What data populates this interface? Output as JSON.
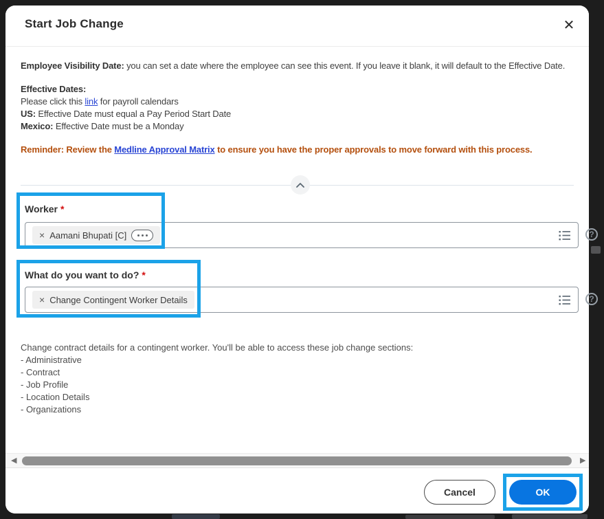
{
  "window": {
    "title": "Start Job Change"
  },
  "icons": {
    "close": "✕",
    "remove": "×",
    "help": "?",
    "scroll_left": "◀",
    "scroll_right": "▶"
  },
  "notices": {
    "visibility_label": "Employee Visibility Date:",
    "visibility_text": " you can set a date where the employee can see this event. If you leave it blank, it will default to the Effective Date.",
    "effective_heading": "Effective Dates:",
    "payroll_before": "Please click this ",
    "payroll_link": "link",
    "payroll_after": " for payroll calendars",
    "us_label": "US:",
    "us_text": " Effective Date must equal a Pay Period Start Date",
    "mexico_label": "Mexico:",
    "mexico_text": " Effective Date must be a Monday",
    "reminder_before": "Reminder: Review the ",
    "reminder_link": "Medline Approval Matrix",
    "reminder_after": " to ensure you have the proper approvals to move forward with this process."
  },
  "fields": {
    "worker": {
      "label": "Worker",
      "required_mark": "*",
      "selected_tag": "Aamani Bhupati [C]"
    },
    "action": {
      "label": "What do you want to do?",
      "required_mark": "*",
      "selected_tag": "Change Contingent Worker Details"
    }
  },
  "description": {
    "intro": "Change contract details for a contingent worker. You'll be able to access these job change sections:",
    "items": [
      "- Administrative",
      "- Contract",
      "- Job Profile",
      "- Location Details",
      "- Organizations"
    ]
  },
  "footer": {
    "cancel_label": "Cancel",
    "ok_label": "OK"
  },
  "colors": {
    "ok_blue": "#0875E1",
    "highlight_blue": "#1BA2E8",
    "reminder_orange": "#B4500F",
    "link_blue": "#2945D4"
  }
}
